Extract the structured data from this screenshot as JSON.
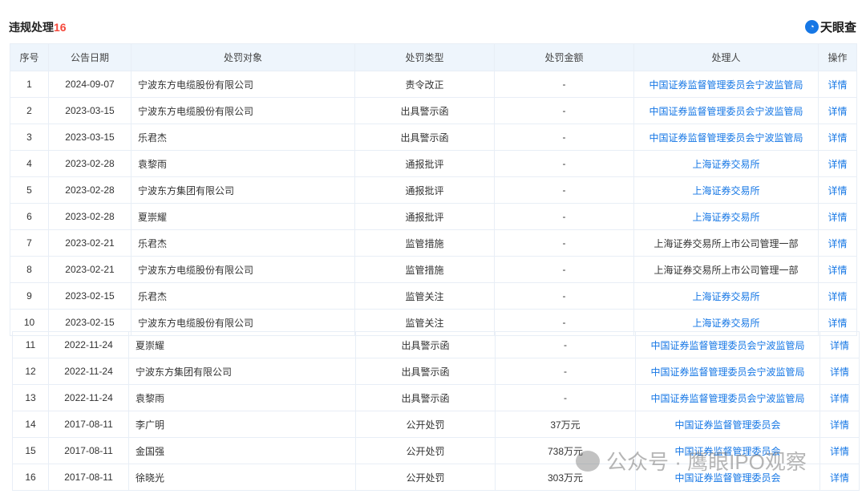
{
  "header": {
    "title": "违规处理",
    "count": "16",
    "logo": "天眼查"
  },
  "columns": [
    "序号",
    "公告日期",
    "处罚对象",
    "处罚类型",
    "处罚金额",
    "处理人",
    "操作"
  ],
  "rows": [
    {
      "no": "1",
      "date": "2024-09-07",
      "target": "宁波东方电缆股份有限公司",
      "type": "责令改正",
      "amount": "-",
      "handler": "中国证券监督管理委员会宁波监管局",
      "handler_link": true,
      "action": "详情"
    },
    {
      "no": "2",
      "date": "2023-03-15",
      "target": "宁波东方电缆股份有限公司",
      "type": "出具警示函",
      "amount": "-",
      "handler": "中国证券监督管理委员会宁波监管局",
      "handler_link": true,
      "action": "详情"
    },
    {
      "no": "3",
      "date": "2023-03-15",
      "target": "乐君杰",
      "type": "出具警示函",
      "amount": "-",
      "handler": "中国证券监督管理委员会宁波监管局",
      "handler_link": true,
      "action": "详情"
    },
    {
      "no": "4",
      "date": "2023-02-28",
      "target": "袁黎雨",
      "type": "通报批评",
      "amount": "-",
      "handler": "上海证券交易所",
      "handler_link": true,
      "action": "详情"
    },
    {
      "no": "5",
      "date": "2023-02-28",
      "target": "宁波东方集团有限公司",
      "type": "通报批评",
      "amount": "-",
      "handler": "上海证券交易所",
      "handler_link": true,
      "action": "详情"
    },
    {
      "no": "6",
      "date": "2023-02-28",
      "target": "夏崇耀",
      "type": "通报批评",
      "amount": "-",
      "handler": "上海证券交易所",
      "handler_link": true,
      "action": "详情"
    },
    {
      "no": "7",
      "date": "2023-02-21",
      "target": "乐君杰",
      "type": "监管措施",
      "amount": "-",
      "handler": "上海证券交易所上市公司管理一部",
      "handler_link": false,
      "action": "详情"
    },
    {
      "no": "8",
      "date": "2023-02-21",
      "target": "宁波东方电缆股份有限公司",
      "type": "监管措施",
      "amount": "-",
      "handler": "上海证券交易所上市公司管理一部",
      "handler_link": false,
      "action": "详情"
    },
    {
      "no": "9",
      "date": "2023-02-15",
      "target": "乐君杰",
      "type": "监管关注",
      "amount": "-",
      "handler": "上海证券交易所",
      "handler_link": true,
      "action": "详情"
    },
    {
      "no": "10",
      "date": "2023-02-15",
      "target": "宁波东方电缆股份有限公司",
      "type": "监管关注",
      "amount": "-",
      "handler": "上海证券交易所",
      "handler_link": true,
      "action": "详情"
    },
    {
      "no": "11",
      "date": "2022-11-24",
      "target": "夏崇耀",
      "type": "出具警示函",
      "amount": "-",
      "handler": "中国证券监督管理委员会宁波监管局",
      "handler_link": true,
      "action": "详情"
    },
    {
      "no": "12",
      "date": "2022-11-24",
      "target": "宁波东方集团有限公司",
      "type": "出具警示函",
      "amount": "-",
      "handler": "中国证券监督管理委员会宁波监管局",
      "handler_link": true,
      "action": "详情"
    },
    {
      "no": "13",
      "date": "2022-11-24",
      "target": "袁黎雨",
      "type": "出具警示函",
      "amount": "-",
      "handler": "中国证券监督管理委员会宁波监管局",
      "handler_link": true,
      "action": "详情"
    },
    {
      "no": "14",
      "date": "2017-08-11",
      "target": "李广明",
      "type": "公开处罚",
      "amount": "37万元",
      "handler": "中国证券监督管理委员会",
      "handler_link": true,
      "action": "详情"
    },
    {
      "no": "15",
      "date": "2017-08-11",
      "target": "金国强",
      "type": "公开处罚",
      "amount": "738万元",
      "handler": "中国证券监督管理委员会",
      "handler_link": true,
      "action": "详情"
    },
    {
      "no": "16",
      "date": "2017-08-11",
      "target": "徐晓光",
      "type": "公开处罚",
      "amount": "303万元",
      "handler": "中国证券监督管理委员会",
      "handler_link": true,
      "action": "详情"
    }
  ],
  "watermark": "公众号 · 鹰眼IPO观察"
}
